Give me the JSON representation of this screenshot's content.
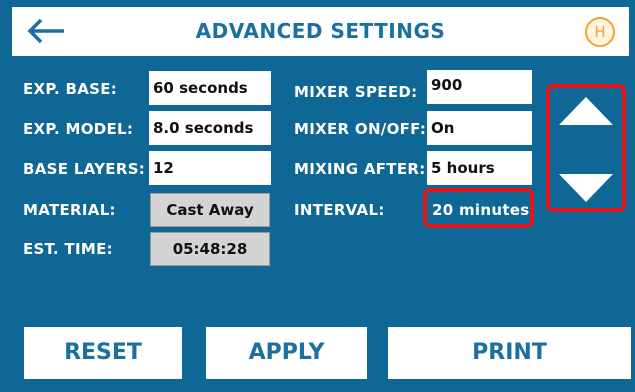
{
  "header": {
    "title": "ADVANCED SETTINGS",
    "back_icon": "back-arrow-icon",
    "logo_letter": "H",
    "logo_color": "#f0a23a"
  },
  "settings_left": [
    {
      "label": "EXP. BASE:",
      "value": "60 seconds",
      "editable": true
    },
    {
      "label": "EXP. MODEL:",
      "value": "8.0 seconds",
      "editable": true
    },
    {
      "label": "BASE LAYERS:",
      "value": "12",
      "editable": true
    },
    {
      "label": "MATERIAL:",
      "value": "Cast Away",
      "editable": false
    },
    {
      "label": "EST. TIME:",
      "value": "05:48:28",
      "editable": false
    }
  ],
  "settings_right": [
    {
      "label": "MIXER SPEED:",
      "value": "900"
    },
    {
      "label": "MIXER ON/OFF:",
      "value": "On"
    },
    {
      "label": "MIXING AFTER:",
      "value": "5 hours"
    },
    {
      "label": "INTERVAL:",
      "value": "20 minutes"
    }
  ],
  "scroll": {
    "up_icon": "triangle-up-icon",
    "down_icon": "triangle-down-icon"
  },
  "highlight_color": "#e3141e",
  "background_color": "#0f6796",
  "buttons": {
    "reset": "RESET",
    "apply": "APPLY",
    "print": "PRINT"
  }
}
